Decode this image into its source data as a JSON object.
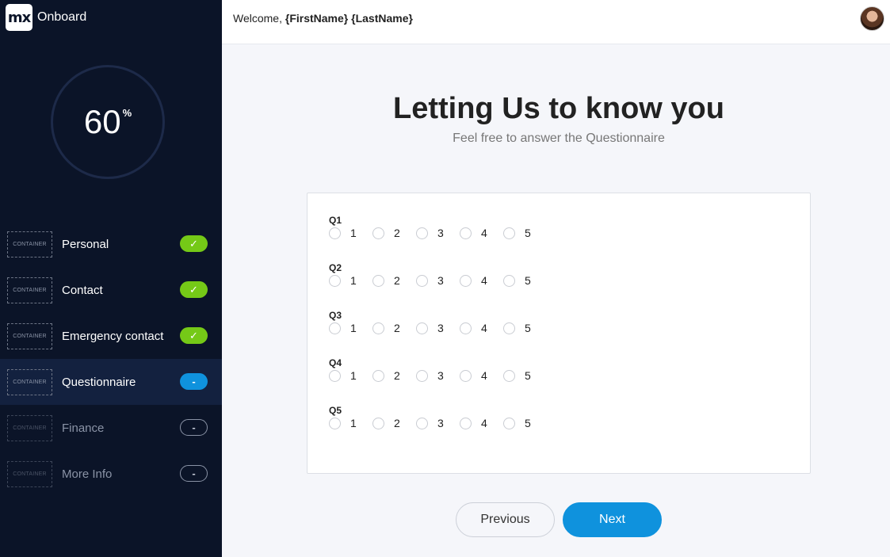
{
  "brand": {
    "logo_text": "mx",
    "app_name": "Onboard"
  },
  "progress": {
    "value": "60",
    "unit": "%"
  },
  "steps": [
    {
      "container": "CONTAINER",
      "label": "Personal",
      "status": "done",
      "badge": "✓"
    },
    {
      "container": "CONTAINER",
      "label": "Contact",
      "status": "done",
      "badge": "✓"
    },
    {
      "container": "CONTAINER",
      "label": "Emergency contact",
      "status": "done",
      "badge": "✓"
    },
    {
      "container": "CONTAINER",
      "label": "Questionnaire",
      "status": "current",
      "badge": "-"
    },
    {
      "container": "CONTAINER",
      "label": "Finance",
      "status": "pending",
      "badge": "-"
    },
    {
      "container": "CONTAINER",
      "label": "More Info",
      "status": "pending",
      "badge": "-"
    }
  ],
  "header": {
    "welcome": "Welcome,",
    "first_name": "{FirstName}",
    "last_name": "{LastName}"
  },
  "main": {
    "title": "Letting Us to know you",
    "subtitle": "Feel free to answer the Questionnaire",
    "questions": [
      {
        "label": "Q1",
        "options": [
          "1",
          "2",
          "3",
          "4",
          "5"
        ]
      },
      {
        "label": "Q2",
        "options": [
          "1",
          "2",
          "3",
          "4",
          "5"
        ]
      },
      {
        "label": "Q3",
        "options": [
          "1",
          "2",
          "3",
          "4",
          "5"
        ]
      },
      {
        "label": "Q4",
        "options": [
          "1",
          "2",
          "3",
          "4",
          "5"
        ]
      },
      {
        "label": "Q5",
        "options": [
          "1",
          "2",
          "3",
          "4",
          "5"
        ]
      }
    ],
    "prev_label": "Previous",
    "next_label": "Next"
  },
  "colors": {
    "sidebar_bg": "#0b1428",
    "active_step_bg": "#13213f",
    "done_badge": "#75c917",
    "accent": "#0f92dd"
  },
  "icons": {
    "done": "check-icon",
    "user": "avatar"
  }
}
